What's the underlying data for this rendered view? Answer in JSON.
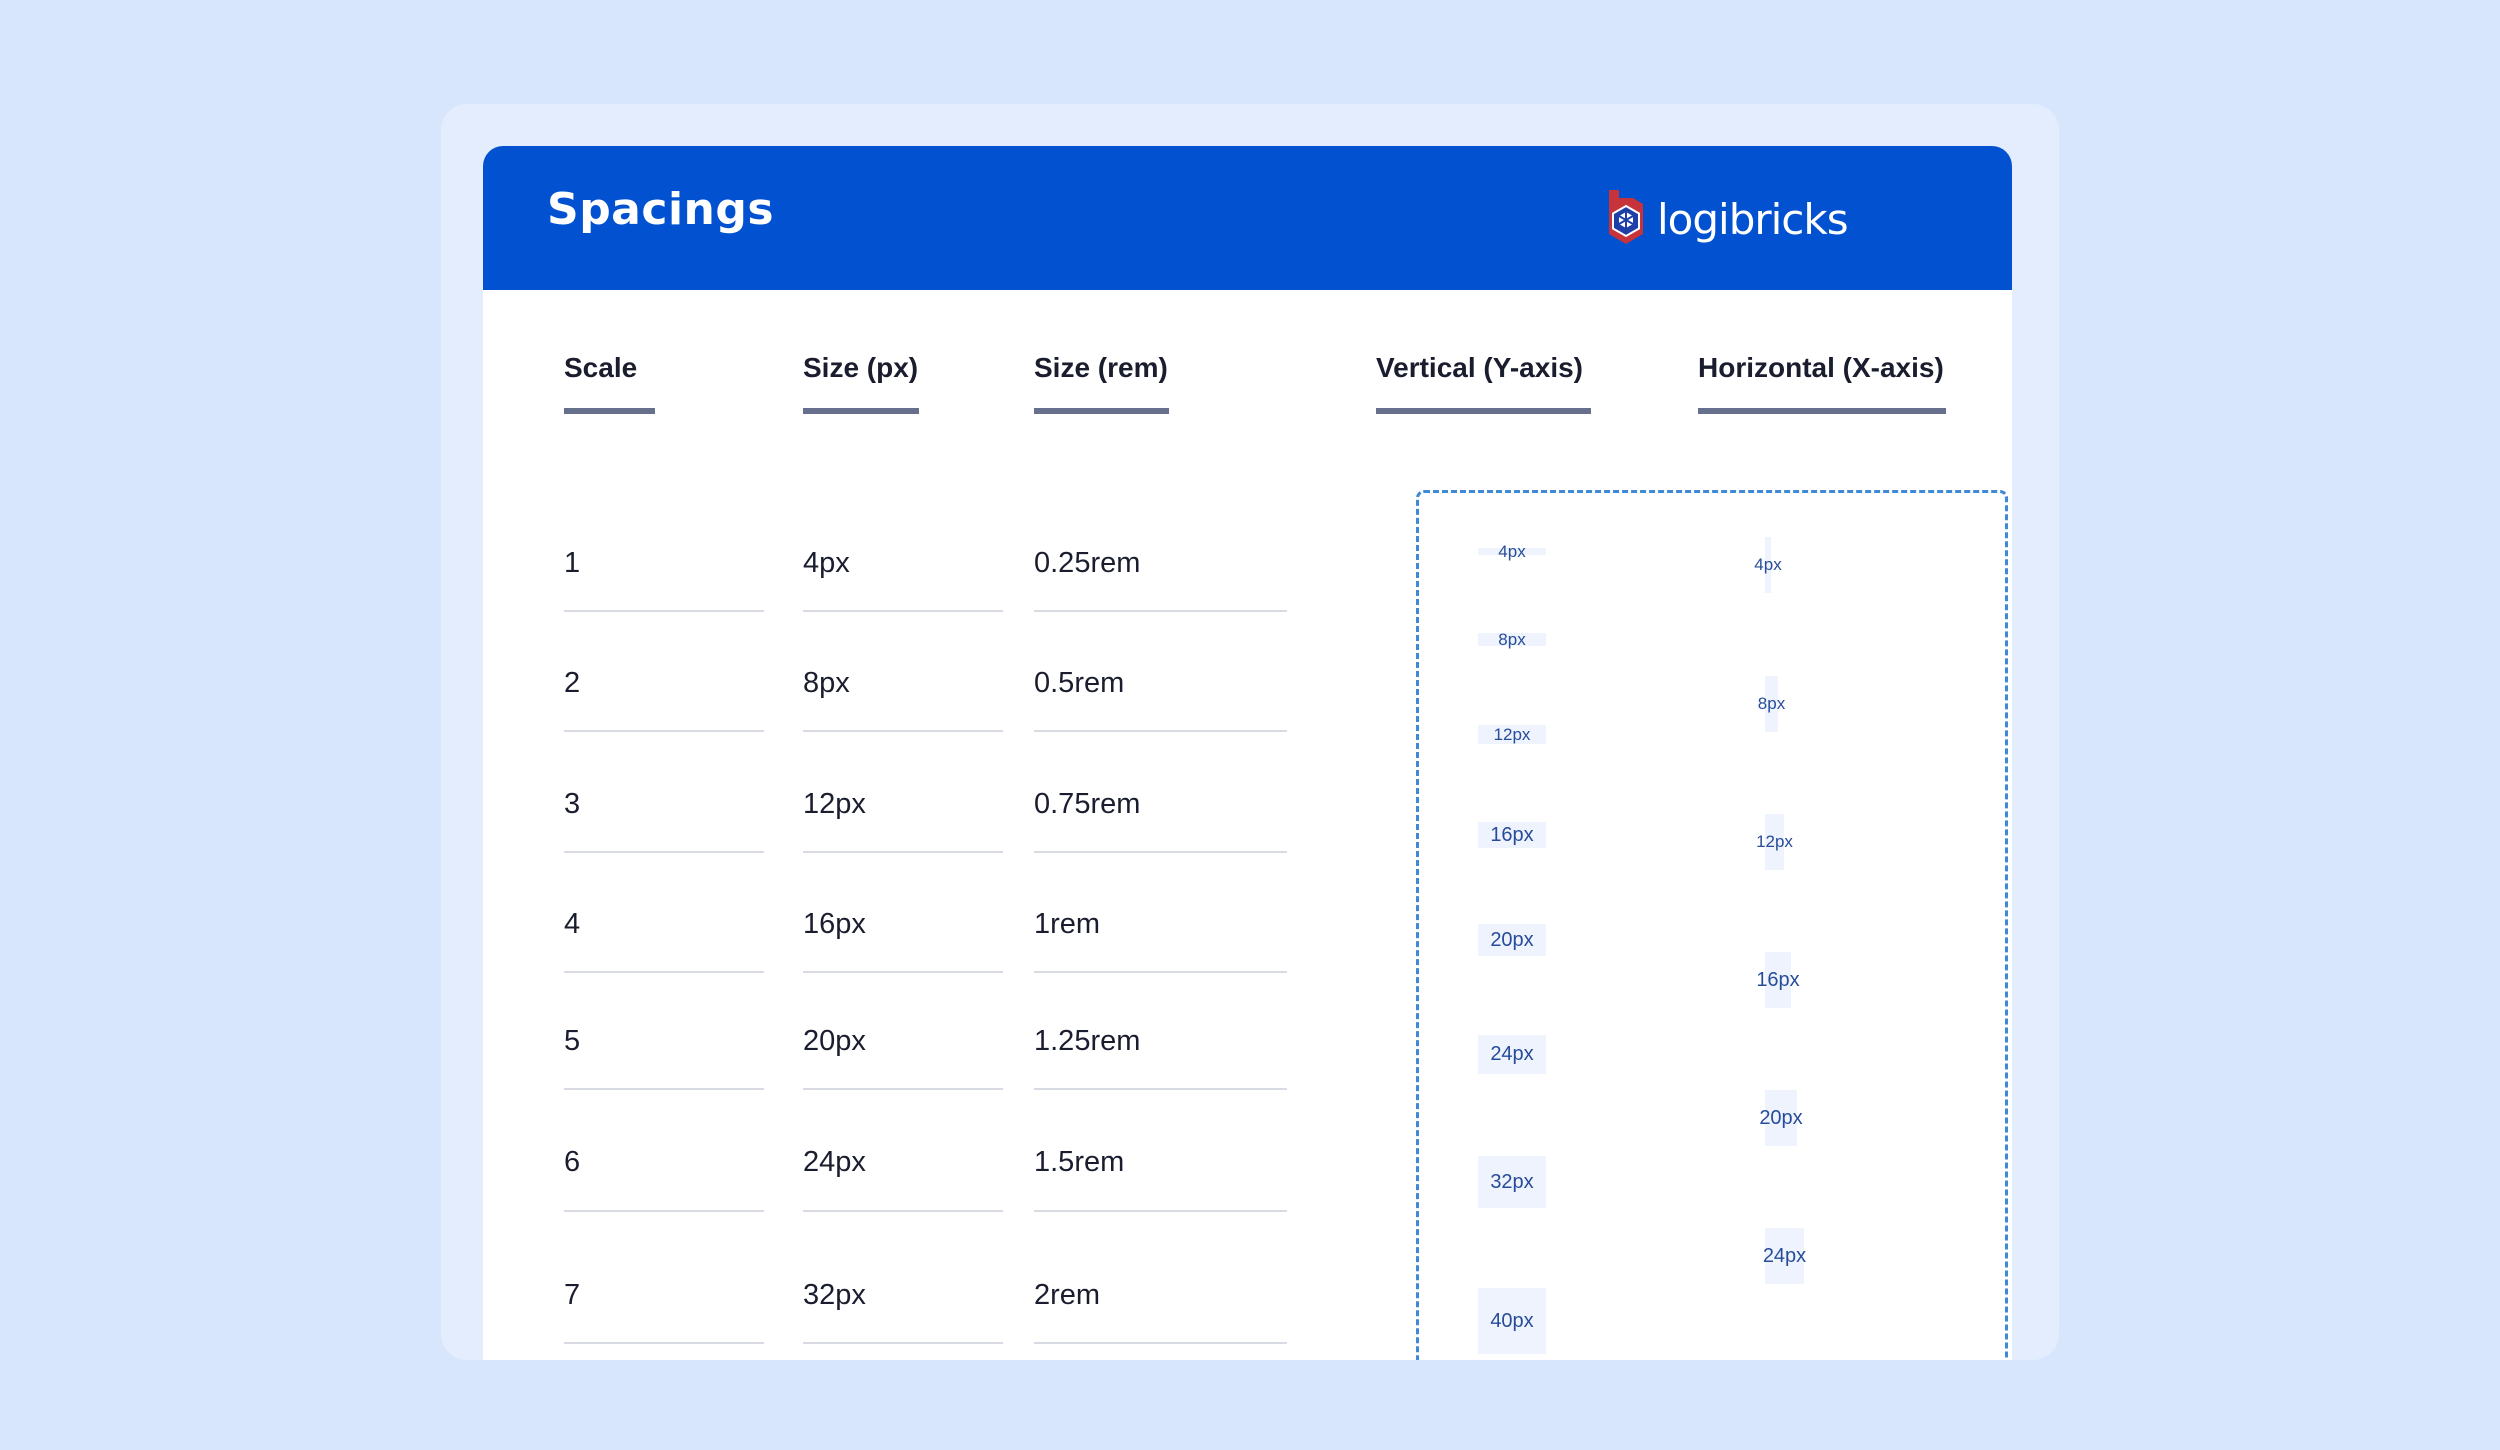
{
  "header": {
    "title": "Spacings",
    "logo_text": "logibricks",
    "logo_icon": "logibricks-hexagon-logo",
    "background_color": "#0251d0"
  },
  "columns": {
    "scale": "Scale",
    "size_px": "Size (px)",
    "size_rem": "Size (rem)",
    "vertical": "Vertical (Y-axis)",
    "horizontal": "Horizontal (X-axis)"
  },
  "rows": [
    {
      "scale": "1",
      "px": "4px",
      "rem": "0.25rem"
    },
    {
      "scale": "2",
      "px": "8px",
      "rem": "0.5rem"
    },
    {
      "scale": "3",
      "px": "12px",
      "rem": "0.75rem"
    },
    {
      "scale": "4",
      "px": "16px",
      "rem": "1rem"
    },
    {
      "scale": "5",
      "px": "20px",
      "rem": "1.25rem"
    },
    {
      "scale": "6",
      "px": "24px",
      "rem": "1.5rem"
    },
    {
      "scale": "7",
      "px": "32px",
      "rem": "2rem"
    }
  ],
  "vertical_samples": [
    "4px",
    "8px",
    "12px",
    "16px",
    "20px",
    "24px",
    "32px",
    "40px"
  ],
  "horizontal_samples": [
    "4px",
    "8px",
    "12px",
    "16px",
    "20px",
    "24px"
  ],
  "colors": {
    "page_background": "#d8e6fd",
    "chip_background": "#eef3fd",
    "chip_text": "#274c9a",
    "dashed_border": "#3f8ad8",
    "header_underline": "#666f8c"
  }
}
